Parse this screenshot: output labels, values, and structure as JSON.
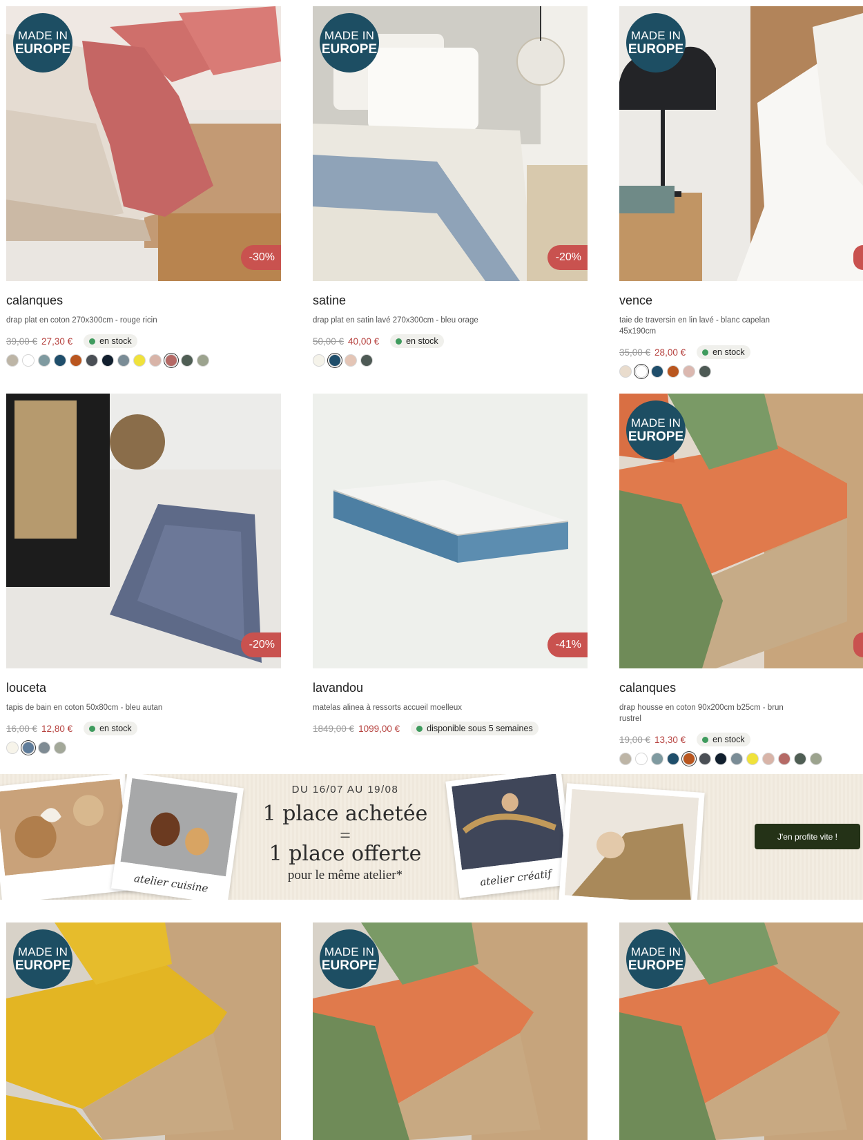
{
  "badges": {
    "made_in_l1": "MADE IN",
    "made_in_l2": "EUROPE"
  },
  "products": [
    {
      "title": "calanques",
      "desc": "drap plat en coton 270x300cm - rouge ricin",
      "old_price": "39,00 €",
      "new_price": "27,30 €",
      "stock": "en stock",
      "discount": "-30%",
      "swatches": [
        "#bdb5a6",
        "#ffffff",
        "#7f9aa0",
        "#1f4e6b",
        "#b9561f",
        "#4a4f55",
        "#111f2e",
        "#7a8c96",
        "#f0e23b",
        "#d8b4a8",
        "#b56a66",
        "#4f5e54",
        "#9ca38e"
      ],
      "selected": 10
    },
    {
      "title": "satine",
      "desc": "drap plat en satin lavé 270x300cm - bleu orage",
      "old_price": "50,00 €",
      "new_price": "40,00 €",
      "stock": "en stock",
      "discount": "-20%",
      "swatches": [
        "#f5f3ea",
        "#1f4e6b",
        "#e4c5b6",
        "#4e5a55"
      ],
      "selected": 1
    },
    {
      "title": "vence",
      "desc": "taie de traversin en lin lavé - blanc capelan 45x190cm",
      "old_price": "35,00 €",
      "new_price": "28,00 €",
      "stock": "en stock",
      "discount": "",
      "swatches": [
        "#e9dccd",
        "#ffffff",
        "#1f4e6b",
        "#b9561f",
        "#dbb8b0",
        "#4e5a55"
      ],
      "selected": 1
    },
    {
      "title": "louceta",
      "desc": "tapis de bain en coton 50x80cm - bleu autan",
      "old_price": "16,00 €",
      "new_price": "12,80 €",
      "stock": "en stock",
      "discount": "-20%",
      "swatches": [
        "#f7f4ea",
        "#5f7c9a",
        "#7f8b93",
        "#a3a899"
      ],
      "selected": 1
    },
    {
      "title": "lavandou",
      "desc": "matelas alinea à ressorts accueil moelleux",
      "old_price": "1849,00 €",
      "new_price": "1099,00 €",
      "stock": "disponible sous 5 semaines",
      "discount": "-41%",
      "swatches": [],
      "selected": -1
    },
    {
      "title": "calanques",
      "desc": "drap housse en coton 90x200cm b25cm - brun rustrel",
      "old_price": "19,00 €",
      "new_price": "13,30 €",
      "stock": "en stock",
      "discount": "",
      "swatches": [
        "#bdb5a6",
        "#ffffff",
        "#7f9aa0",
        "#1f4e6b",
        "#b9561f",
        "#4a4f55",
        "#111f2e",
        "#7a8c96",
        "#f0e23b",
        "#d8b4a8",
        "#b56a66",
        "#4f5e54",
        "#9ca38e"
      ],
      "selected": 4
    }
  ],
  "banner": {
    "dates": "DU 16/07 AU 19/08",
    "line1": "1 place achetée",
    "equals": "=",
    "line2": "1 place offerte",
    "line3": "pour le même atelier*",
    "caption_left": "atelier cuisine",
    "caption_right": "atelier créatif",
    "cta": "J'en profite vite !"
  },
  "colors": {
    "discount": "#c9524f",
    "badge": "#1d4e63",
    "price_new": "#b6423f",
    "stock_dot": "#3f9b5e",
    "cta": "#243217"
  }
}
